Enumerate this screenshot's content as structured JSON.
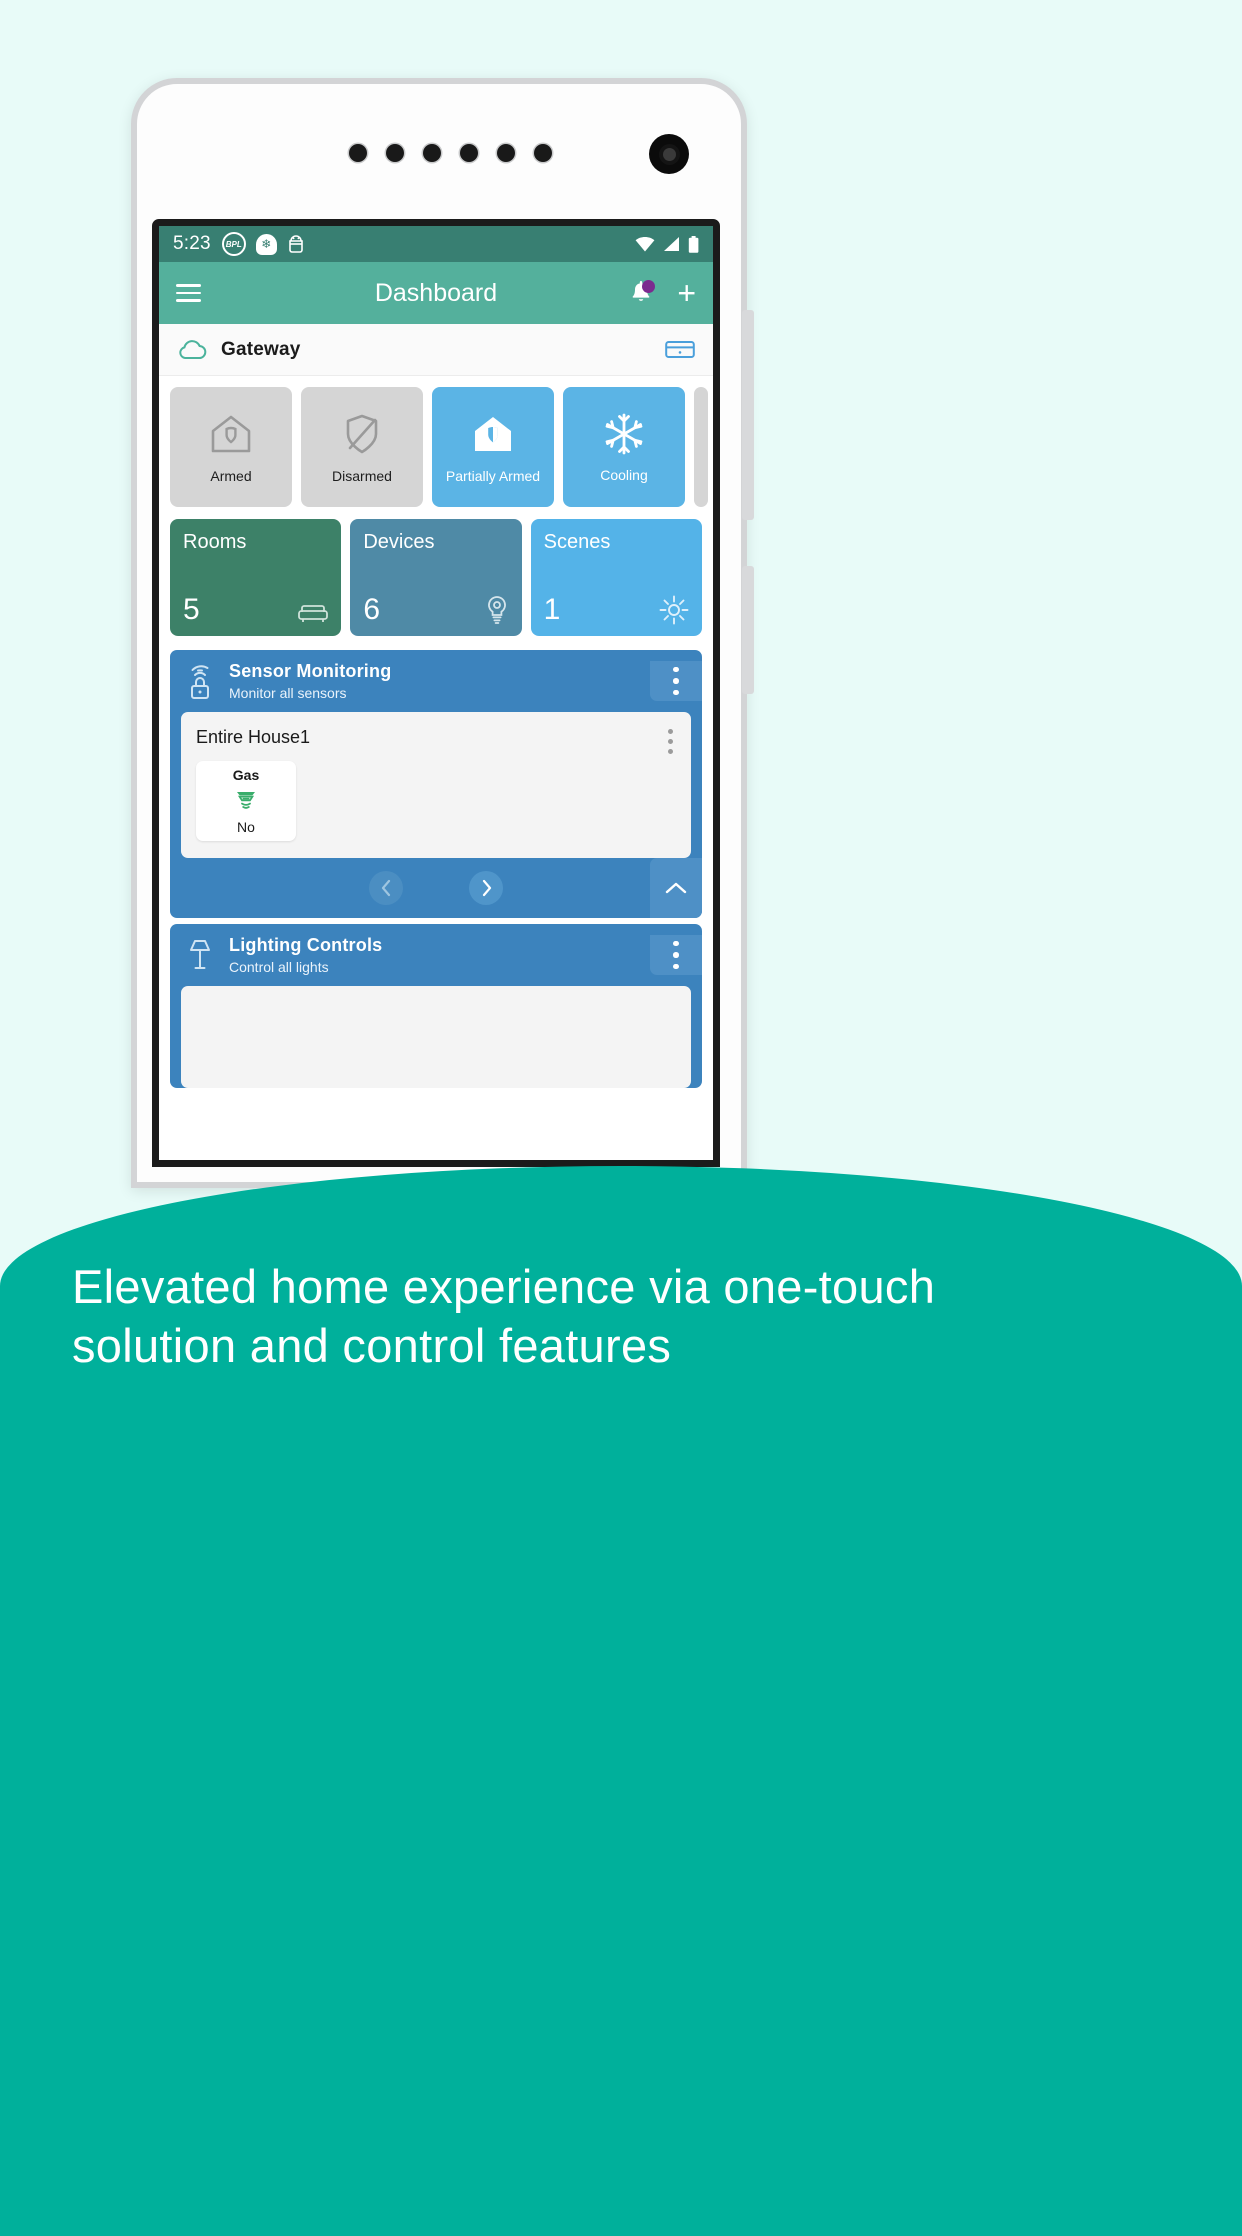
{
  "statusbar": {
    "time": "5:23",
    "icons": [
      "bpl-badge-icon",
      "home-snowflake-icon",
      "android-icon"
    ],
    "right_icons": [
      "wifi-icon",
      "cellular-signal-icon",
      "battery-icon"
    ]
  },
  "appbar": {
    "menu_icon": "hamburger-menu-icon",
    "title": "Dashboard",
    "notification_icon": "bell-icon",
    "add_icon": "plus-icon",
    "background": "#54b09c"
  },
  "gateway": {
    "label": "Gateway",
    "cloud_icon": "cloud-icon",
    "device_icon": "gateway-device-icon"
  },
  "modes": [
    {
      "label": "Armed",
      "icon": "home-shield-outline-icon",
      "active": false
    },
    {
      "label": "Disarmed",
      "icon": "shield-slash-icon",
      "active": false
    },
    {
      "label": "Partially Armed",
      "icon": "home-shield-filled-icon",
      "active": true
    },
    {
      "label": "Cooling",
      "icon": "snowflake-icon",
      "active": true
    }
  ],
  "stats": [
    {
      "title": "Rooms",
      "count": "5",
      "icon": "sofa-icon",
      "color": "#3d8168"
    },
    {
      "title": "Devices",
      "count": "6",
      "icon": "lightbulb-icon",
      "color": "#4f8aa6"
    },
    {
      "title": "Scenes",
      "count": "1",
      "icon": "sun-icon",
      "color": "#54b3e8"
    }
  ],
  "sensor_section": {
    "title": "Sensor Monitoring",
    "subtitle": "Monitor all sensors",
    "icon": "wireless-sensor-icon",
    "menu_icon": "kebab-menu-icon",
    "card": {
      "title": "Entire House1",
      "menu_icon": "kebab-menu-icon",
      "sensors": [
        {
          "name": "Gas",
          "value": "No",
          "icon": "gas-detector-icon"
        }
      ]
    },
    "pager": {
      "prev_icon": "chevron-left-icon",
      "next_icon": "chevron-right-icon",
      "collapse_icon": "chevron-up-icon"
    }
  },
  "lighting_section": {
    "title": "Lighting Controls",
    "subtitle": "Control all lights",
    "icon": "lamp-icon",
    "menu_icon": "kebab-menu-icon"
  },
  "caption": {
    "text": "Elevated home experience via one-touch solution and control features"
  },
  "colors": {
    "page_background": "#e8fbf8",
    "footer": "#00b09b",
    "status_bar": "#387f72",
    "panel_blue": "#3c83bd",
    "badge_purple": "#7b2b8f"
  }
}
